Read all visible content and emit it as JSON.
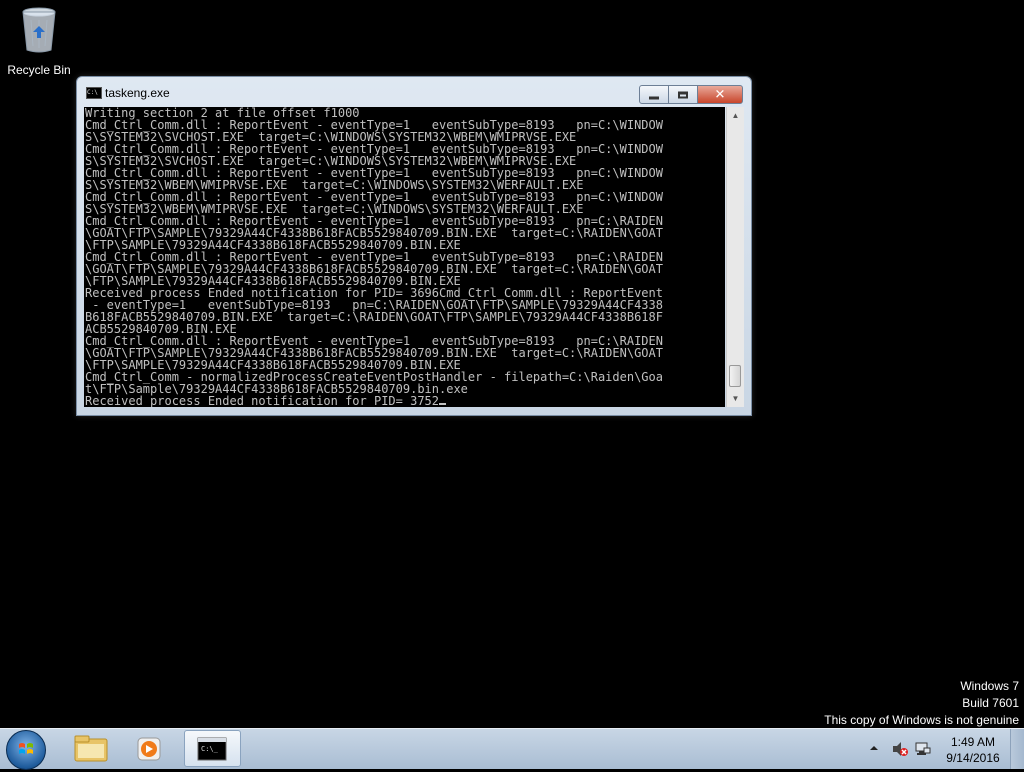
{
  "desktop": {
    "recycle_bin_label": "Recycle Bin"
  },
  "window": {
    "title": "taskeng.exe",
    "icon": "cmd-icon",
    "close_glyph": "✕"
  },
  "console": {
    "lines": [
      "Writing section 2 at file offset f1000",
      "Cmd_Ctrl_Comm.dll : ReportEvent - eventType=1   eventSubType=8193   pn=C:\\WINDOW",
      "S\\SYSTEM32\\SVCHOST.EXE  target=C:\\WINDOWS\\SYSTEM32\\WBEM\\WMIPRVSE.EXE",
      "Cmd_Ctrl_Comm.dll : ReportEvent - eventType=1   eventSubType=8193   pn=C:\\WINDOW",
      "S\\SYSTEM32\\SVCHOST.EXE  target=C:\\WINDOWS\\SYSTEM32\\WBEM\\WMIPRVSE.EXE",
      "Cmd_Ctrl_Comm.dll : ReportEvent - eventType=1   eventSubType=8193   pn=C:\\WINDOW",
      "S\\SYSTEM32\\WBEM\\WMIPRVSE.EXE  target=C:\\WINDOWS\\SYSTEM32\\WERFAULT.EXE",
      "Cmd_Ctrl_Comm.dll : ReportEvent - eventType=1   eventSubType=8193   pn=C:\\WINDOW",
      "S\\SYSTEM32\\WBEM\\WMIPRVSE.EXE  target=C:\\WINDOWS\\SYSTEM32\\WERFAULT.EXE",
      "Cmd_Ctrl_Comm.dll : ReportEvent - eventType=1   eventSubType=8193   pn=C:\\RAIDEN",
      "\\GOAT\\FTP\\SAMPLE\\79329A44CF4338B618FACB5529840709.BIN.EXE  target=C:\\RAIDEN\\GOAT",
      "\\FTP\\SAMPLE\\79329A44CF4338B618FACB5529840709.BIN.EXE",
      "Cmd_Ctrl_Comm.dll : ReportEvent - eventType=1   eventSubType=8193   pn=C:\\RAIDEN",
      "\\GOAT\\FTP\\SAMPLE\\79329A44CF4338B618FACB5529840709.BIN.EXE  target=C:\\RAIDEN\\GOAT",
      "\\FTP\\SAMPLE\\79329A44CF4338B618FACB5529840709.BIN.EXE",
      "Received process Ended notification for PID= 3696Cmd_Ctrl_Comm.dll : ReportEvent",
      " - eventType=1   eventSubType=8193   pn=C:\\RAIDEN\\GOAT\\FTP\\SAMPLE\\79329A44CF4338",
      "B618FACB5529840709.BIN.EXE  target=C:\\RAIDEN\\GOAT\\FTP\\SAMPLE\\79329A44CF4338B618F",
      "ACB5529840709.BIN.EXE",
      "Cmd_Ctrl_Comm.dll : ReportEvent - eventType=1   eventSubType=8193   pn=C:\\RAIDEN",
      "\\GOAT\\FTP\\SAMPLE\\79329A44CF4338B618FACB5529840709.BIN.EXE  target=C:\\RAIDEN\\GOAT",
      "\\FTP\\SAMPLE\\79329A44CF4338B618FACB5529840709.BIN.EXE",
      "Cmd_Ctrl_Comm - normalizedProcessCreateEventPostHandler - filepath=C:\\Raiden\\Goa",
      "t\\FTP\\Sample\\79329A44CF4338B618FACB5529840709.bin.exe"
    ],
    "last_line": "Received process Ended notification for PID= 3752"
  },
  "watermark": {
    "line1": "Windows 7",
    "line2": "Build 7601",
    "line3": "This copy of Windows is not genuine"
  },
  "taskbar": {
    "pinned": [
      "windows-explorer-icon",
      "media-player-icon",
      "cmd-icon"
    ],
    "clock_time": "1:49 AM",
    "clock_date": "9/14/2016"
  }
}
